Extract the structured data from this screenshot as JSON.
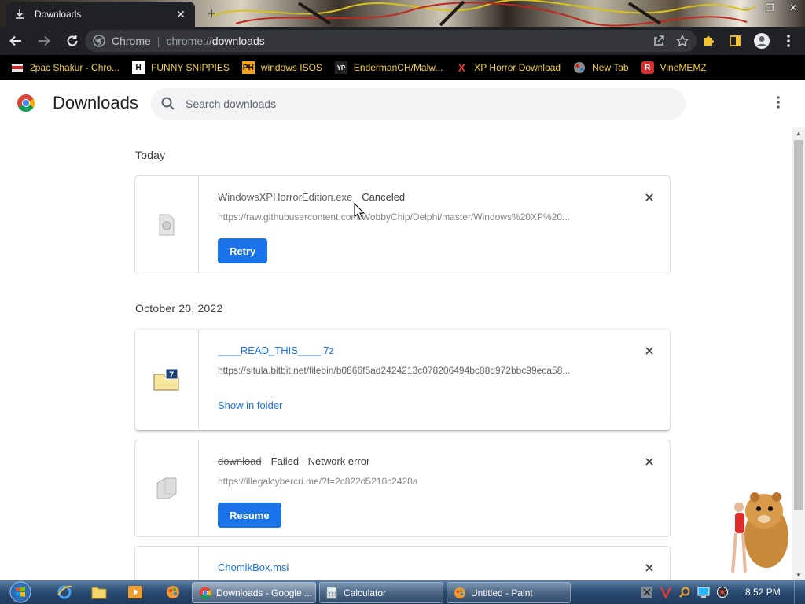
{
  "browser": {
    "tab": {
      "title": "Downloads",
      "close": "✕"
    },
    "new_tab": "+",
    "window_controls": [
      "–",
      "❐",
      "✕"
    ],
    "omnibox": {
      "site_label": "Chrome",
      "separator": "|",
      "url_scheme": "chrome://",
      "url_host": "downloads"
    },
    "bookmarks": [
      {
        "label": "2pac Shakur - Chro...",
        "icon": "folder-icon",
        "icon_text": ""
      },
      {
        "label": "FUNNY SNIPPIES",
        "icon": "h-site-icon",
        "icon_text": "H"
      },
      {
        "label": "windows ISOS",
        "icon": "ph-site-icon",
        "icon_text": "PH"
      },
      {
        "label": "EndermanCH/Malw...",
        "icon": "yp-site-icon",
        "icon_text": "YP"
      },
      {
        "label": "XP Horror Download",
        "icon": "x-site-icon",
        "icon_text": "X"
      },
      {
        "label": "New Tab",
        "icon": "globe-icon",
        "icon_text": ""
      },
      {
        "label": "VineMEMZ",
        "icon": "r-site-icon",
        "icon_text": "R"
      }
    ],
    "accent": "#1a73e8"
  },
  "page": {
    "title": "Downloads",
    "search_placeholder": "Search downloads",
    "groups": [
      {
        "date": "Today",
        "items": [
          {
            "name": "WindowsXPHorrorEdition.exe",
            "status": "Canceled",
            "url": "https://raw.githubusercontent.com/WobbyChip/Delphi/master/Windows%20XP%20...",
            "action": "Retry"
          }
        ]
      },
      {
        "date": "October 20, 2022",
        "items": [
          {
            "name": "____READ_THIS____.7z",
            "status": "",
            "url": "https://situla.bitbit.net/filebin/b0866f5ad2424213c078206494bc88d972bbc99eca58...",
            "action": "Show in folder"
          },
          {
            "name": "download",
            "status": "Failed - Network error",
            "url": "https://illegalcybercri.me/?f=2c822d5210c2428a",
            "action": "Resume"
          },
          {
            "name": "ChomikBox.msi",
            "status": "",
            "url": "",
            "action": ""
          }
        ]
      }
    ]
  },
  "taskbar": {
    "windows": [
      {
        "label": "Downloads - Google ...",
        "icon": "chrome-icon",
        "active": true
      },
      {
        "label": "Calculator",
        "icon": "calculator-icon",
        "active": false
      },
      {
        "label": "Untitled - Paint",
        "icon": "paint-icon",
        "active": false
      }
    ],
    "clock": "8:52 PM"
  }
}
